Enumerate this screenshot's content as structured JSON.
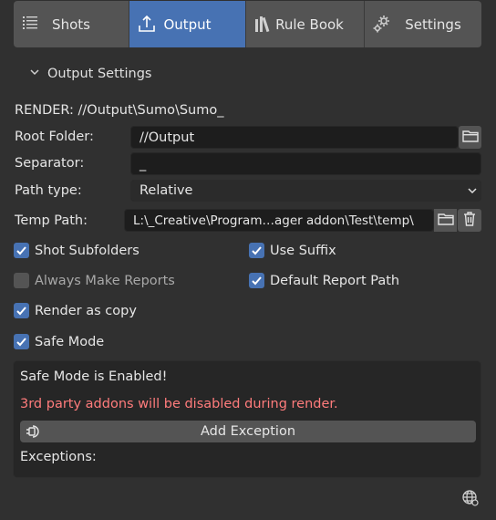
{
  "tabs": [
    {
      "label": "Shots",
      "icon": "shots-icon",
      "active": false
    },
    {
      "label": "Output",
      "icon": "upload-icon",
      "active": true
    },
    {
      "label": "Rule Book",
      "icon": "library-icon",
      "active": false
    },
    {
      "label": "Settings",
      "icon": "gears-icon",
      "active": false
    }
  ],
  "section": {
    "title": "Output Settings",
    "expanded": true
  },
  "render_path": "RENDER: //Output\\Sumo\\Sumo_",
  "root_folder": {
    "label": "Root Folder:",
    "value": "//Output"
  },
  "separator": {
    "label": "Separator:",
    "value": "_"
  },
  "path_type": {
    "label": "Path type:",
    "value": "Relative"
  },
  "temp_path": {
    "label": "Temp Path:",
    "value": "L:\\_Creative\\Program…ager addon\\Test\\temp\\"
  },
  "options": {
    "shot_subfolders": {
      "label": "Shot Subfolders",
      "checked": true
    },
    "use_suffix": {
      "label": "Use Suffix",
      "checked": true
    },
    "always_make_reports": {
      "label": "Always Make Reports",
      "checked": false
    },
    "default_report_path": {
      "label": "Default Report Path",
      "checked": true
    },
    "render_as_copy": {
      "label": "Render as copy",
      "checked": true
    },
    "safe_mode": {
      "label": "Safe Mode",
      "checked": true
    }
  },
  "safe_mode_box": {
    "title": "Safe Mode is Enabled!",
    "warning": "3rd party addons will be disabled during render.",
    "warning_color": "#ff7c7c",
    "add_button": "Add Exception",
    "exceptions_label": "Exceptions:"
  },
  "colors": {
    "accent": "#4772b3",
    "background": "#303030",
    "field": "#1d1d1d"
  }
}
